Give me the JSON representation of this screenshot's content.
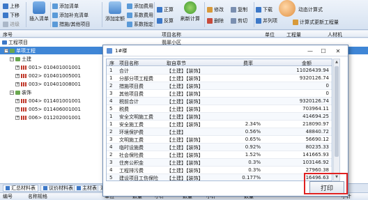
{
  "ribbon": {
    "move_up": "上移",
    "move_down": "下移",
    "step_in": "进级",
    "insert_list": "插入清单",
    "add_list": "添加清单",
    "add_supplement": "添加补充清单",
    "measures_other": "措施/其他项目",
    "add_quota": "添加定额",
    "add_fee": "添加费用",
    "coef_fee": "系数费用",
    "coef_assign": "系数指定",
    "forward": "正算",
    "reverse": "反算",
    "refresh": "刷新计算",
    "modify": "修改",
    "delete": "删除",
    "copy": "复制",
    "paste": "剪切",
    "download": "下载",
    "merge_list": "并列项",
    "formula": "动态计算式",
    "formula_update": "计算式更新工程量"
  },
  "main_columns": [
    "序号",
    "项目名称",
    "单位",
    "工程量",
    "人材机"
  ],
  "tree": {
    "project": "工程项目",
    "project_name": "翡翠小区",
    "unit_project": "单项工程",
    "group1": "土建",
    "group1_items": [
      "001> 010401001001",
      "002> 010401005001",
      "003> 010401008001"
    ],
    "group2": "装饰",
    "group2_items": [
      "004> 011401001001",
      "005> 011406001001",
      "006> 011202001001"
    ]
  },
  "bottom_tabs": [
    "汇总材料表",
    "议价材料表",
    "主材表",
    "汇总"
  ],
  "bottom_columns": [
    "编号",
    "名称规格",
    "单位",
    "数量",
    "小计",
    "数量",
    "小计",
    "数量",
    "小计"
  ],
  "dialog": {
    "title": "1#楼",
    "minimize": "—",
    "maximize": "☐",
    "close": "✕",
    "columns": [
      "序",
      "项目名称",
      "取自章节",
      "费率",
      "金额"
    ],
    "rows": [
      {
        "no": "1",
        "name": "合计",
        "source": "【土建】【装饰】",
        "rate": "",
        "amount": "11026439.94"
      },
      {
        "no": "1",
        "name": "分部分项工程费",
        "source": "【土建】【装饰】",
        "rate": "",
        "amount": "9320126.74"
      },
      {
        "no": "2",
        "name": "措施项目费",
        "source": "【土建】【装饰】",
        "rate": "",
        "amount": "0"
      },
      {
        "no": "3",
        "name": "其他项目费",
        "source": "【土建】【装饰】",
        "rate": "",
        "amount": "0"
      },
      {
        "no": "4",
        "name": "税前合计",
        "source": "【土建】【装饰】",
        "rate": "",
        "amount": "9320126.74"
      },
      {
        "no": "5",
        "name": "税费",
        "source": "【土建】【装饰】",
        "rate": "",
        "amount": "703964.11"
      },
      {
        "no": "1",
        "name": "安全文明施工费",
        "source": "【土建】【装饰】",
        "rate": "",
        "amount": "414694.25"
      },
      {
        "no": "1",
        "name": "安全施工费",
        "source": "【土建】【装饰】",
        "rate": "2.34%",
        "amount": "218090.97"
      },
      {
        "no": "2",
        "name": "环境保护费",
        "source": "【土建】",
        "rate": "0.56%",
        "amount": "48840.72"
      },
      {
        "no": "3",
        "name": "文明施工费",
        "source": "【土建】【装饰】",
        "rate": "0.65%",
        "amount": "56690.12"
      },
      {
        "no": "4",
        "name": "临时设施费",
        "source": "【土建】【装饰】",
        "rate": "0.92%",
        "amount": "80235.33"
      },
      {
        "no": "2",
        "name": "社会保险费",
        "source": "【土建】【装饰】",
        "rate": "1.52%",
        "amount": "141665.93"
      },
      {
        "no": "3",
        "name": "住房公积金",
        "source": "【土建】【装饰】",
        "rate": "0.3%",
        "amount": "103146.92"
      },
      {
        "no": "4",
        "name": "工程排污费",
        "source": "【土建】【装饰】",
        "rate": "0.3%",
        "amount": "27960.38"
      },
      {
        "no": "5",
        "name": "建设项目工伤保险",
        "source": "【土建】【装饰】",
        "rate": "0.177%",
        "amount": "16496.63"
      }
    ],
    "print_label": "打印"
  },
  "colors": {
    "selection": "#3f86d6",
    "highlight_box": "#e02020",
    "dialog_border": "#6f8db5"
  }
}
